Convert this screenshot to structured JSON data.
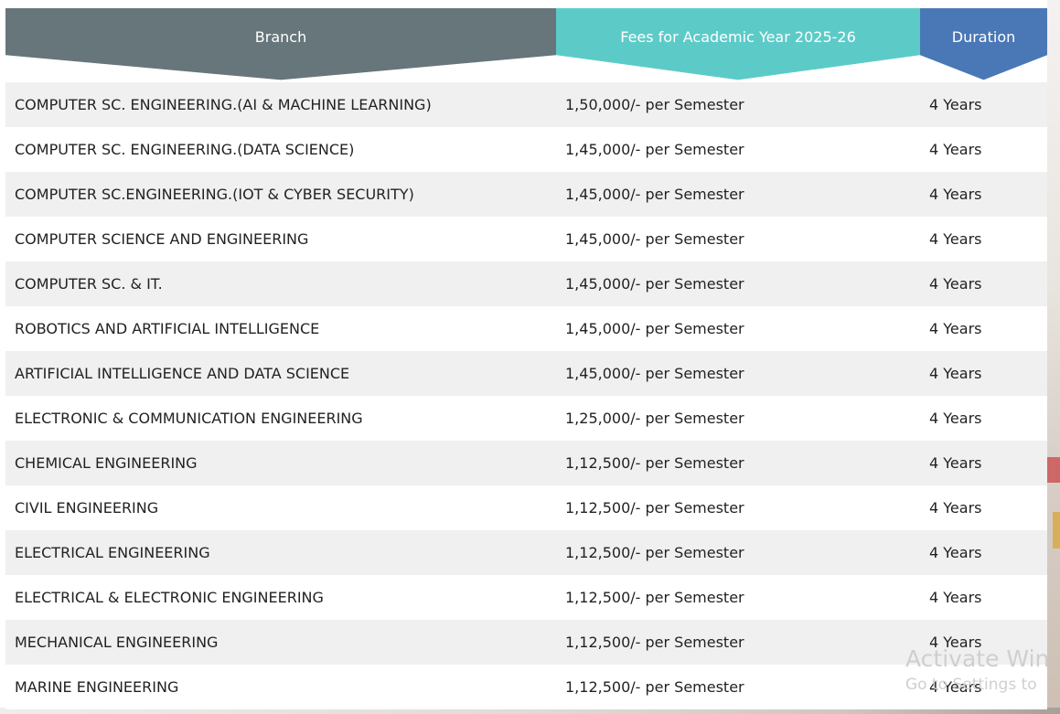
{
  "table": {
    "headers": {
      "branch": "Branch",
      "fees": "Fees for Academic Year 2025-26",
      "duration": "Duration"
    },
    "rows": [
      {
        "branch": "COMPUTER SC. ENGINEERING.(AI & MACHINE LEARNING)",
        "fees": "1,50,000/- per Semester",
        "duration": "4 Years"
      },
      {
        "branch": "COMPUTER SC. ENGINEERING.(DATA SCIENCE)",
        "fees": "1,45,000/- per Semester",
        "duration": "4 Years"
      },
      {
        "branch": "COMPUTER SC.ENGINEERING.(IOT & CYBER SECURITY)",
        "fees": "1,45,000/- per Semester",
        "duration": "4 Years"
      },
      {
        "branch": "COMPUTER SCIENCE AND ENGINEERING",
        "fees": "1,45,000/- per Semester",
        "duration": "4 Years"
      },
      {
        "branch": "COMPUTER SC. & IT.",
        "fees": "1,45,000/- per Semester",
        "duration": "4 Years"
      },
      {
        "branch": "ROBOTICS AND ARTIFICIAL INTELLIGENCE",
        "fees": "1,45,000/- per Semester",
        "duration": "4 Years"
      },
      {
        "branch": "ARTIFICIAL INTELLIGENCE AND DATA SCIENCE",
        "fees": "1,45,000/- per Semester",
        "duration": "4 Years"
      },
      {
        "branch": "ELECTRONIC & COMMUNICATION ENGINEERING",
        "fees": "1,25,000/- per Semester",
        "duration": "4 Years"
      },
      {
        "branch": "CHEMICAL ENGINEERING",
        "fees": "1,12,500/- per Semester",
        "duration": "4 Years"
      },
      {
        "branch": "CIVIL ENGINEERING",
        "fees": "1,12,500/- per Semester",
        "duration": "4 Years"
      },
      {
        "branch": "ELECTRICAL ENGINEERING",
        "fees": "1,12,500/- per Semester",
        "duration": "4 Years"
      },
      {
        "branch": "ELECTRICAL & ELECTRONIC ENGINEERING",
        "fees": "1,12,500/- per Semester",
        "duration": "4 Years"
      },
      {
        "branch": "MECHANICAL ENGINEERING",
        "fees": "1,12,500/- per Semester",
        "duration": "4 Years"
      },
      {
        "branch": "MARINE ENGINEERING",
        "fees": "1,12,500/- per Semester",
        "duration": "4 Years"
      }
    ]
  },
  "watermark": {
    "title": "Activate Win",
    "subtitle": "Go to Settings to"
  },
  "colors": {
    "header_branch": "#66767a",
    "header_fees": "#5ccbc8",
    "header_duration": "#4a78b6",
    "row_alt": "#f0f0f0",
    "text": "#222222"
  }
}
